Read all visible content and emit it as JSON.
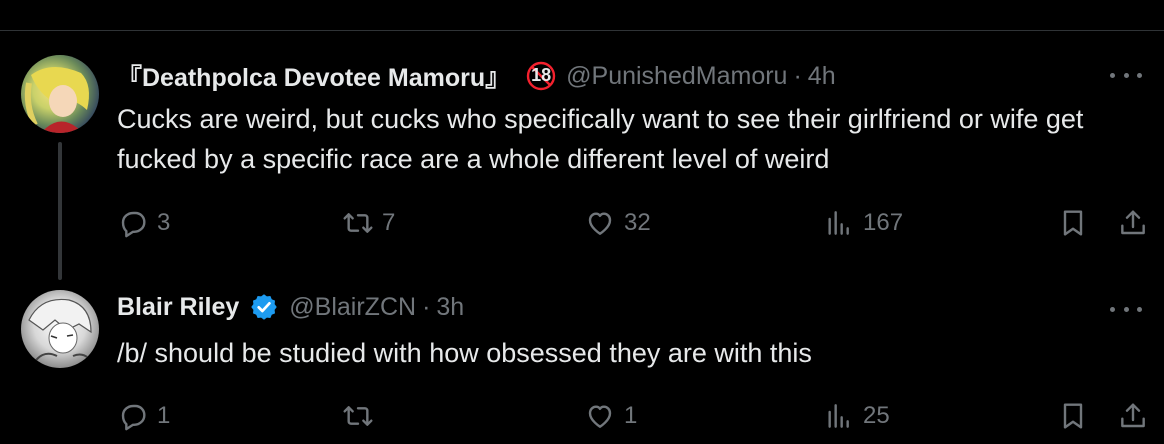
{
  "tweets": [
    {
      "display_name": "『Deathpolca Devotee Mamoru』",
      "age_badge": "18",
      "handle": "@PunishedMamoru",
      "separator": "·",
      "time": "4h",
      "text": "Cucks are weird, but cucks who specifically want to see their girlfriend or wife get fucked by a specific race are a whole different level of weird",
      "replies": "3",
      "reposts": "7",
      "likes": "32",
      "views": "167"
    },
    {
      "display_name": "Blair Riley",
      "verified": true,
      "handle": "@BlairZCN",
      "separator": "·",
      "time": "3h",
      "text": "/b/ should be studied with how obsessed they are with this",
      "replies": "1",
      "reposts": "",
      "likes": "1",
      "views": "25"
    }
  ],
  "colors": {
    "background": "#000000",
    "text_primary": "#e7e9ea",
    "text_secondary": "#71767b",
    "verified_blue": "#1d9bf0",
    "badge_red": "#f4212e",
    "divider": "#2f3336"
  },
  "icons": [
    "reply-icon",
    "repost-icon",
    "like-icon",
    "views-icon",
    "bookmark-icon",
    "share-icon",
    "more-icon",
    "verified-icon",
    "age-restricted-icon"
  ]
}
